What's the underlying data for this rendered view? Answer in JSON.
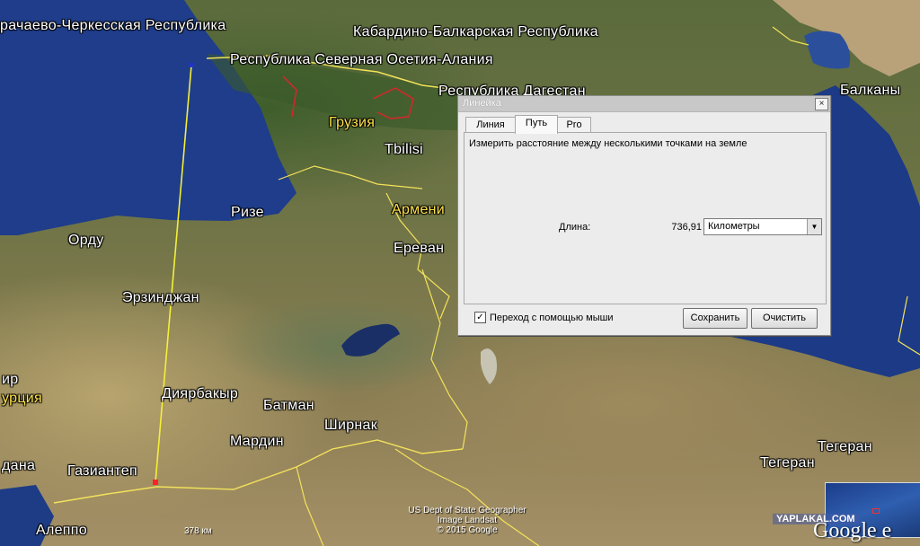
{
  "map": {
    "labels": {
      "karachaevo": "рачаево-Черкесская Республика",
      "kabardino": "Кабардино-Балкарская Республика",
      "osetia": "Республика Северная Осетия-Алания",
      "dagestan": "Республика Дагестан",
      "balkany": "Балканы",
      "gruzia": "Грузия",
      "tbilisi": "Tbilisi",
      "rize": "Ризе",
      "ordu": "Орду",
      "armenia": "Армени",
      "erevan": "Ереван",
      "erzinjan": "Эрзинджан",
      "ir": "ир",
      "turkey": "урция",
      "diyarbakir": "Диярбакыр",
      "batman": "Батман",
      "shirnak": "Ширнак",
      "mardin": "Мардин",
      "dana": "дана",
      "gaziantep": "Газиантеп",
      "aleppo": "Алеппо",
      "tehran1": "Тегеран",
      "tehran2": "Тегеран"
    },
    "attribution": [
      "US Dept of State Geographer",
      "Image Landsat",
      "© 2015 Google"
    ],
    "path_length": "378 км",
    "watermark": "YAPLAKAL.COM",
    "logo": "Google e",
    "colors": {
      "path": "#f4ef3a",
      "border": "#f3e25a",
      "georgia_border": "#d7262b",
      "sea": "#1f3d8a"
    }
  },
  "ruler": {
    "title": "Линейка",
    "close": "×",
    "tabs": [
      "Линия",
      "Путь",
      "Pro"
    ],
    "active_tab": "Путь",
    "description": "Измерить расстояние между несколькими точками на земле",
    "length_label": "Длина:",
    "length_value": "736,91",
    "unit": "Километры",
    "mouse_nav_checked": true,
    "mouse_nav_label": "Переход с помощью мыши",
    "save_label": "Сохранить",
    "clear_label": "Очистить"
  }
}
